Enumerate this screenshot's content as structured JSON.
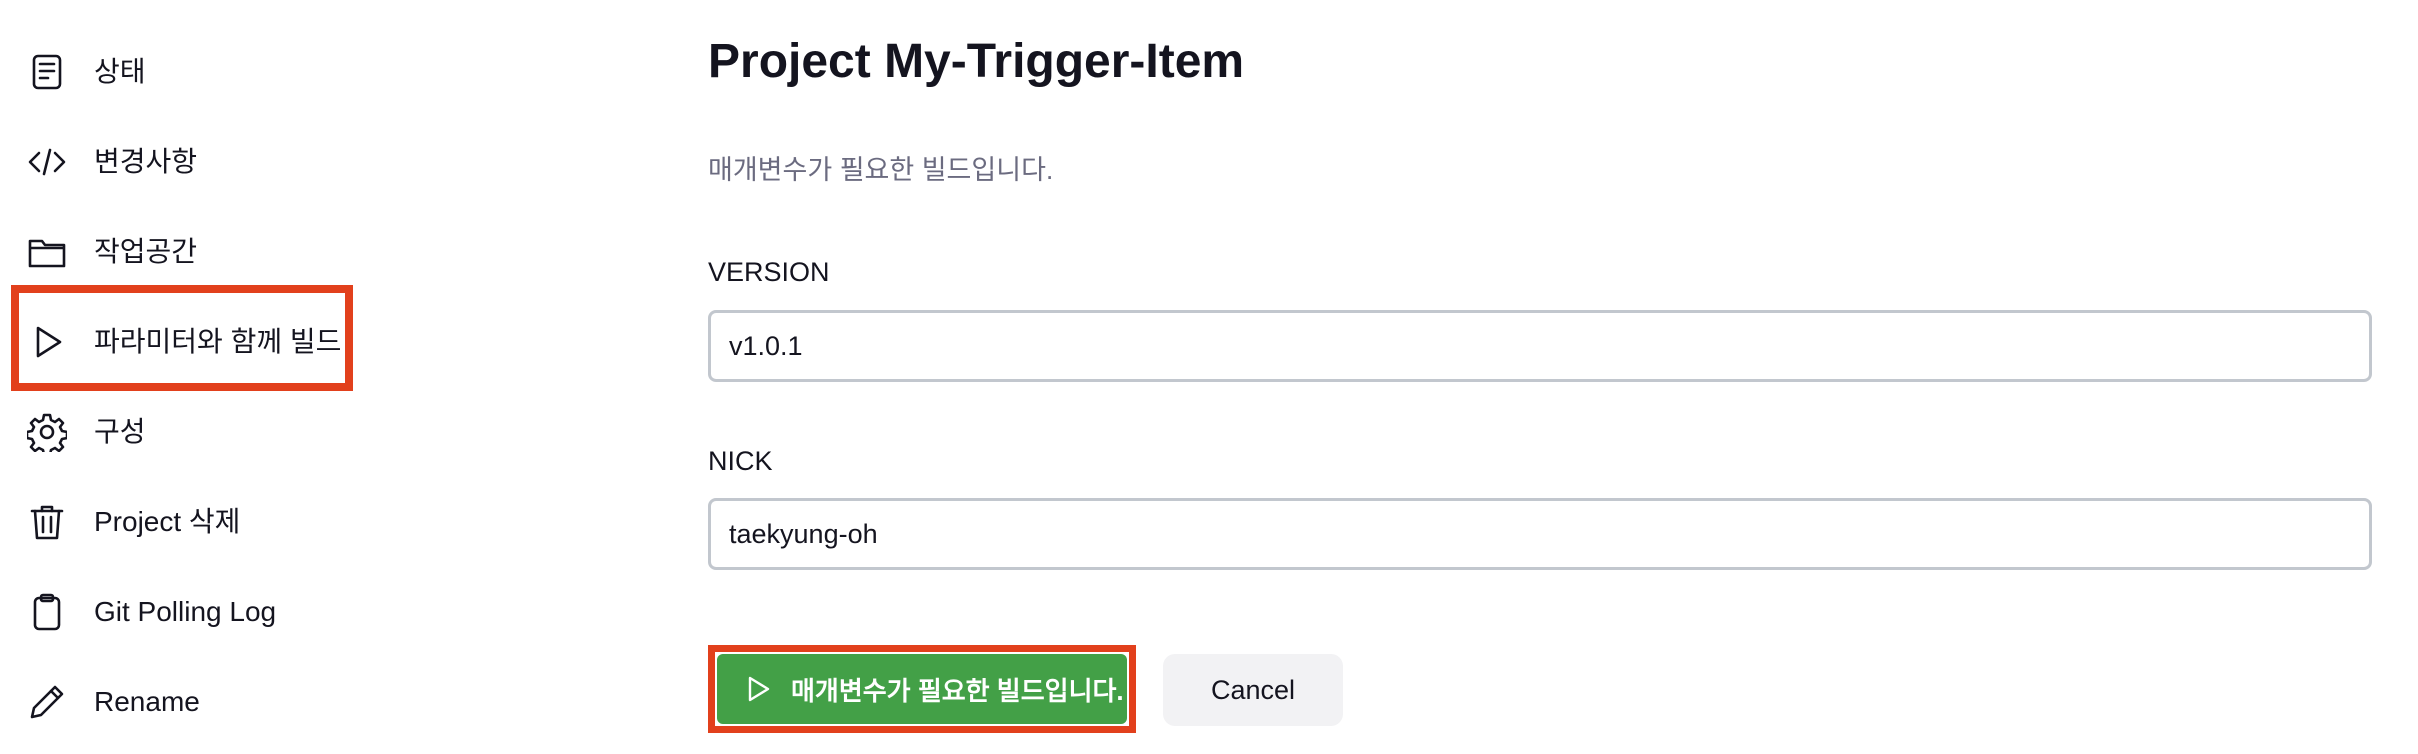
{
  "sidebar": {
    "items": [
      {
        "label": "상태",
        "icon": "document-icon"
      },
      {
        "label": "변경사항",
        "icon": "code-icon"
      },
      {
        "label": "작업공간",
        "icon": "folder-icon"
      },
      {
        "label": "파라미터와 함께 빌드",
        "icon": "play-icon",
        "highlighted": true
      },
      {
        "label": "구성",
        "icon": "gear-icon"
      },
      {
        "label": "Project 삭제",
        "icon": "trash-icon"
      },
      {
        "label": "Git Polling Log",
        "icon": "clipboard-icon"
      },
      {
        "label": "Rename",
        "icon": "pencil-icon"
      }
    ]
  },
  "main": {
    "title": "Project My-Trigger-Item",
    "description": "매개변수가 필요한 빌드입니다.",
    "fields": [
      {
        "label": "VERSION",
        "value": "v1.0.1"
      },
      {
        "label": "NICK",
        "value": "taekyung-oh"
      }
    ],
    "build_button_label": "매개변수가 필요한 빌드입니다.",
    "cancel_button_label": "Cancel"
  },
  "colors": {
    "highlight": "#e2401c",
    "build_button": "#43a047",
    "text": "#14141f",
    "muted_text": "#6b6b80"
  }
}
